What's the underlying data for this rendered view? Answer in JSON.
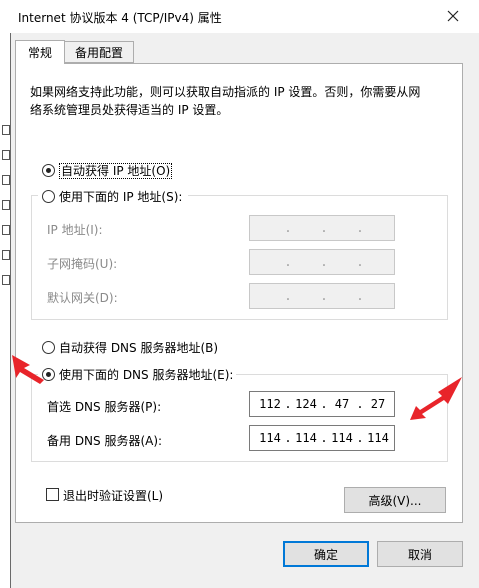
{
  "window": {
    "title": "Internet 协议版本 4 (TCP/IPv4) 属性"
  },
  "tabs": [
    {
      "label": "常规"
    },
    {
      "label": "备用配置"
    }
  ],
  "description": {
    "line1": "如果网络支持此功能，则可以获取自动指派的 IP 设置。否则，你需要从网",
    "line2": "络系统管理员处获得适当的 IP 设置。"
  },
  "ip": {
    "auto_label": "自动获得 IP 地址(O)",
    "manual_label": "使用下面的 IP 地址(S):",
    "selected": "auto",
    "address_label": "IP 地址(I):",
    "mask_label": "子网掩码(U):",
    "gateway_label": "默认网关(D):"
  },
  "dns": {
    "auto_label": "自动获得 DNS 服务器地址(B)",
    "manual_label": "使用下面的 DNS 服务器地址(E):",
    "selected": "manual",
    "preferred_label": "首选 DNS 服务器(P):",
    "preferred": [
      "112",
      "124",
      "47",
      "27"
    ],
    "alternate_label": "备用 DNS 服务器(A):",
    "alternate": [
      "114",
      "114",
      "114",
      "114"
    ]
  },
  "validate_label": "退出时验证设置(L)",
  "advanced_label": "高级(V)...",
  "ok_label": "确定",
  "cancel_label": "取消",
  "annotation_color": "#e8242a"
}
